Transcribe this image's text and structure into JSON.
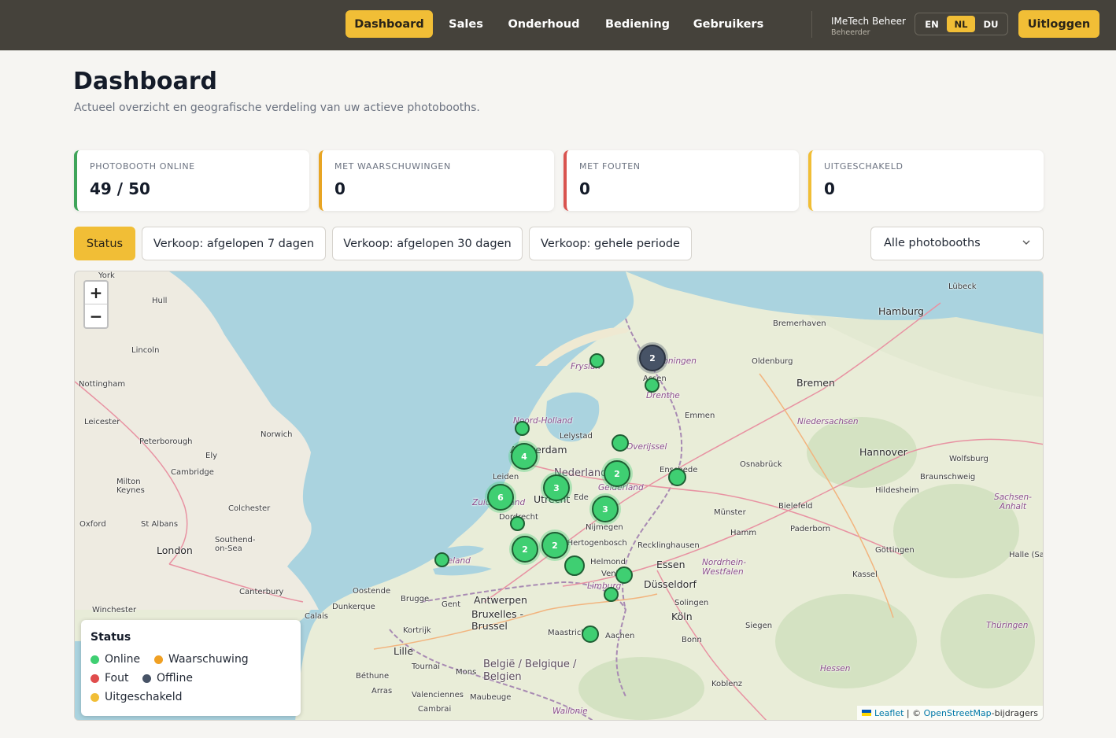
{
  "nav": {
    "items": [
      {
        "label": "Dashboard",
        "active": true
      },
      {
        "label": "Sales",
        "active": false
      },
      {
        "label": "Onderhoud",
        "active": false
      },
      {
        "label": "Bediening",
        "active": false
      },
      {
        "label": "Gebruikers",
        "active": false
      }
    ],
    "user": {
      "name": "IMeTech Beheer",
      "role": "Beheerder"
    },
    "languages": [
      {
        "code": "EN",
        "active": false
      },
      {
        "code": "NL",
        "active": true
      },
      {
        "code": "DU",
        "active": false
      }
    ],
    "logout_label": "Uitloggen"
  },
  "page": {
    "title": "Dashboard",
    "subtitle": "Actueel overzicht en geografische verdeling van uw actieve photobooths."
  },
  "stats": [
    {
      "label": "PHOTOBOOTH ONLINE",
      "value": "49 / 50",
      "color": "#3fa45a"
    },
    {
      "label": "MET WAARSCHUWINGEN",
      "value": "0",
      "color": "#e8a524"
    },
    {
      "label": "MET FOUTEN",
      "value": "0",
      "color": "#d9534f"
    },
    {
      "label": "UITGESCHAKELD",
      "value": "0",
      "color": "#f1be36"
    }
  ],
  "tabs": [
    {
      "label": "Status",
      "active": true
    },
    {
      "label": "Verkoop: afgelopen 7 dagen",
      "active": false
    },
    {
      "label": "Verkoop: afgelopen 30 dagen",
      "active": false
    },
    {
      "label": "Verkoop: gehele periode",
      "active": false
    }
  ],
  "booth_filter": {
    "selected": "Alle photobooths"
  },
  "map": {
    "zoom_in": "+",
    "zoom_out": "−",
    "places": {
      "york": "York",
      "hull": "Hull",
      "lincoln": "Lincoln",
      "nottingham": "Nottingham",
      "leicester": "Leicester",
      "peterborough": "Peterborough",
      "norwich": "Norwich",
      "ely": "Ely",
      "cambridge": "Cambridge",
      "milton_keynes": "Milton Keynes",
      "oxford": "Oxford",
      "st_albans": "St Albans",
      "colchester": "Colchester",
      "london": "London",
      "southend": "Southend-on-Sea",
      "canterbury": "Canterbury",
      "winchester": "Winchester",
      "calais": "Calais",
      "dunkerque": "Dunkerque",
      "oostende": "Oostende",
      "brugge": "Brugge",
      "gent": "Gent",
      "antwerpen": "Antwerpen",
      "bruxelles": "Bruxelles - Brussel",
      "kortrijk": "Kortrijk",
      "lille": "Lille",
      "tournai": "Tournai",
      "mons": "Mons",
      "bethune": "Béthune",
      "arras": "Arras",
      "valenciennes": "Valenciennes",
      "maubeuge": "Maubeuge",
      "cambrai": "Cambrai",
      "belgie": "België / Belgique / Belgien",
      "wallonie": "Wallonie",
      "maastricht": "Maastricht",
      "aachen": "Aachen",
      "bonn": "Bonn",
      "koln": "Köln",
      "solingen": "Solingen",
      "dusseldorf": "Düsseldorf",
      "essen": "Essen",
      "recklinghausen": "Recklinghausen",
      "helmond": "Helmond",
      "venlo": "Venlo",
      "limburg": "Limburg",
      "den_bosch": "'s-Hertogenbosch",
      "zeeland": "Zeeland",
      "dordrecht": "Dordrecht",
      "zuid_holland": "Zuid-Holland",
      "leiden": "Leiden",
      "amsterdam": "Amsterdam",
      "utrecht": "Utrecht",
      "nederland": "Nederland",
      "ede": "Ede",
      "nijmegen": "Nijmegen",
      "gelderland": "Gelderland",
      "lelystad": "Lelystad",
      "noord_holland": "Noord-Holland",
      "friesland": "Fryslân",
      "groningen": "Groningen",
      "assen": "Assen",
      "drenthe": "Drenthe",
      "emmen": "Emmen",
      "overijssel": "Overijssel",
      "enschede": "Enschede",
      "osnabruck": "Osnabrück",
      "munster": "Münster",
      "hamm": "Hamm",
      "bielefeld": "Bielefeld",
      "paderborn": "Paderborn",
      "gottingen": "Göttingen",
      "kassel": "Kassel",
      "siegen": "Siegen",
      "hessen": "Hessen",
      "koblenz": "Koblenz",
      "thuringen": "Thüringen",
      "halle": "Halle (Saale)",
      "nrw": "Nordrhein-Westfalen",
      "hannover": "Hannover",
      "wolfsburg": "Wolfsburg",
      "braunschweig": "Braunschweig",
      "hildesheim": "Hildesheim",
      "sachsen_anhalt": "Sachsen-Anhalt",
      "niedersachsen": "Niedersachsen",
      "bremen": "Bremen",
      "oldenburg": "Oldenburg",
      "bremerhaven": "Bremerhaven",
      "hamburg": "Hamburg",
      "lubeck": "Lübeck"
    },
    "markers": [
      {
        "label": "",
        "status": "online"
      },
      {
        "label": "2",
        "status": "offline"
      },
      {
        "label": "",
        "status": "online"
      },
      {
        "label": "",
        "status": "online"
      },
      {
        "label": "",
        "status": "online"
      },
      {
        "label": "4",
        "status": "online"
      },
      {
        "label": "2",
        "status": "online"
      },
      {
        "label": "",
        "status": "online"
      },
      {
        "label": "3",
        "status": "online"
      },
      {
        "label": "6",
        "status": "online"
      },
      {
        "label": "3",
        "status": "online"
      },
      {
        "label": "",
        "status": "online"
      },
      {
        "label": "2",
        "status": "online"
      },
      {
        "label": "2",
        "status": "online"
      },
      {
        "label": "",
        "status": "online"
      },
      {
        "label": "",
        "status": "online"
      },
      {
        "label": "",
        "status": "online"
      },
      {
        "label": "",
        "status": "online"
      },
      {
        "label": "",
        "status": "online"
      }
    ],
    "legend": {
      "title": "Status",
      "items": [
        {
          "label": "Online",
          "color": "#3fcf72"
        },
        {
          "label": "Waarschuwing",
          "color": "#f0a023"
        },
        {
          "label": "Fout",
          "color": "#e04c4c"
        },
        {
          "label": "Offline",
          "color": "#475366"
        },
        {
          "label": "Uitgeschakeld",
          "color": "#f1be36"
        }
      ]
    },
    "attribution": {
      "leaflet": "Leaflet",
      "separator": " | © ",
      "osm": "OpenStreetMap",
      "suffix": "-bijdragers"
    }
  }
}
